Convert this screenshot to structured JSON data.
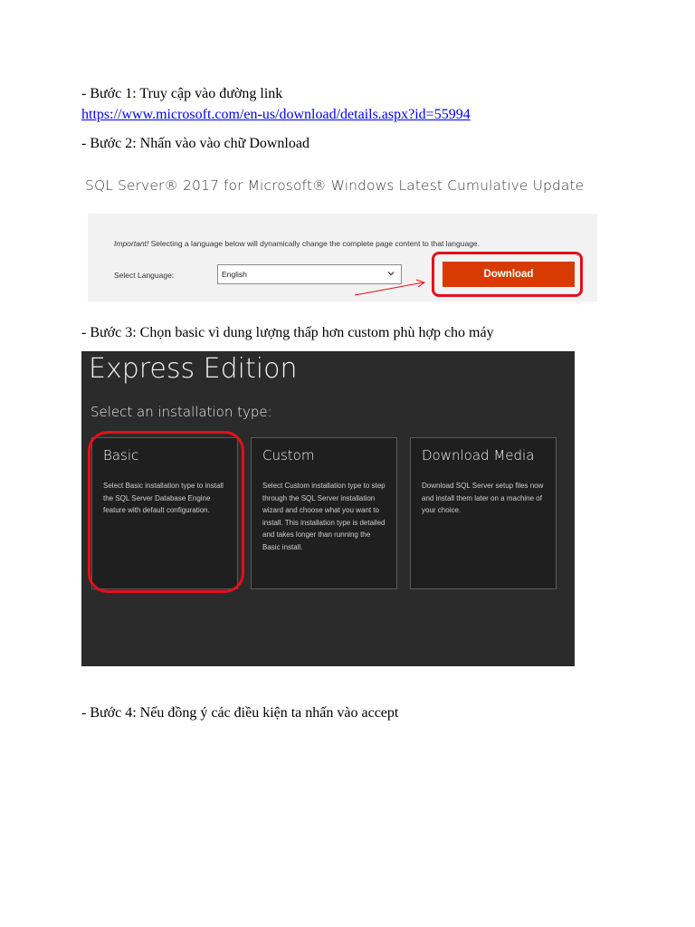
{
  "steps": {
    "step1_text": "- Bước 1: Truy cập vào đường link",
    "step1_link": "https://www.microsoft.com/en-us/download/details.aspx?id=55994",
    "step2_text": "- Bước 2: Nhấn vào vào chữ Download",
    "step3_text": "- Bước 3: Chọn basic vì dung lượng thấp hơn custom phù hợp cho máy",
    "step4_text": "- Bước 4: Nếu đồng ý các điều kiện ta nhấn vào accept"
  },
  "ms_page": {
    "title": "SQL Server® 2017 for Microsoft® Windows Latest Cumulative Update",
    "important_label": "Important!",
    "important_text": " Selecting a language below will dynamically change the complete page content to that language.",
    "select_language_label": "Select Language:",
    "language_value": "English",
    "download_label": "Download",
    "colors": {
      "download_button": "#d83b01",
      "highlight": "#e3101a"
    }
  },
  "installer": {
    "title": "Express Edition",
    "subtitle": "Select an installation type:",
    "options": [
      {
        "title": "Basic",
        "description": "Select Basic installation type to install the SQL Server Database Engine feature with default configuration."
      },
      {
        "title": "Custom",
        "description": "Select Custom installation type to step through the SQL Server installation wizard and choose what you want to install. This installation type is detailed and takes longer than running the Basic install."
      },
      {
        "title": "Download Media",
        "description": "Download SQL Server setup files now and install them later on a machine of your choice."
      }
    ],
    "colors": {
      "background": "#2b2b2b",
      "card": "#1f1f1f",
      "highlight": "#e3101a"
    }
  }
}
